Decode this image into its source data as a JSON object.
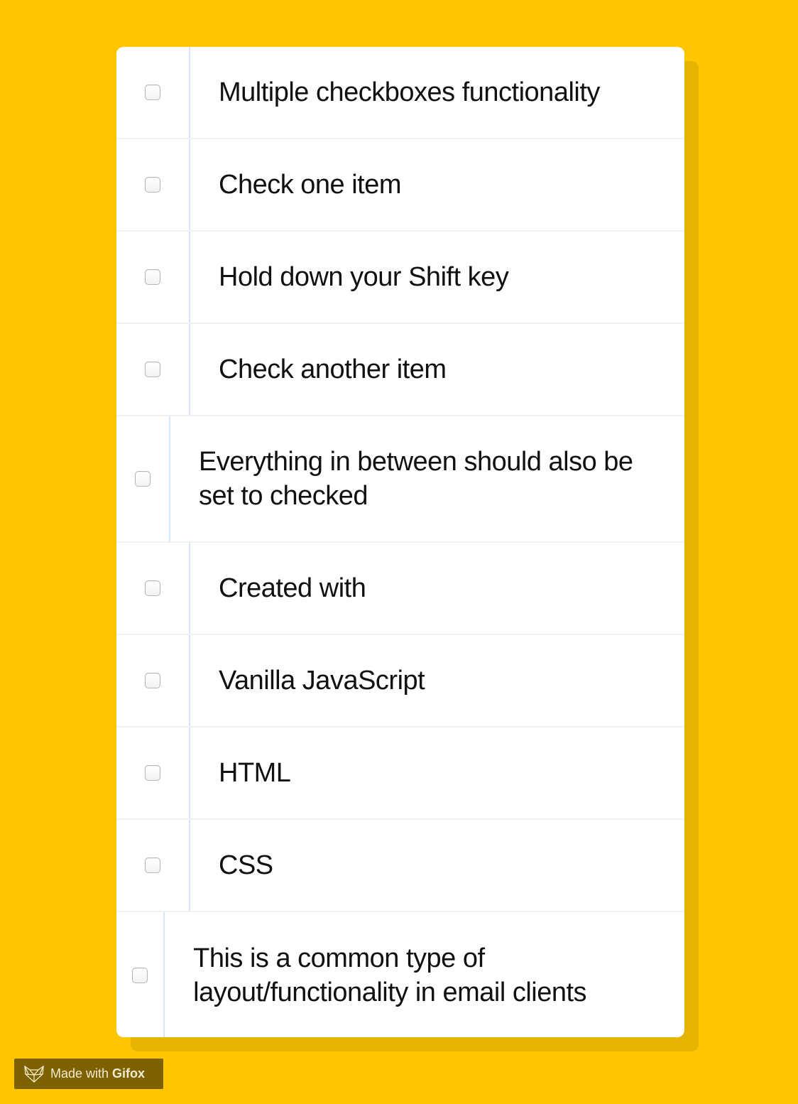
{
  "items": [
    {
      "label": "Multiple checkboxes functionality",
      "checked": false
    },
    {
      "label": "Check one item",
      "checked": false
    },
    {
      "label": "Hold down your Shift key",
      "checked": false
    },
    {
      "label": "Check another item",
      "checked": false
    },
    {
      "label": "Everything in between should also be set to checked",
      "checked": false
    },
    {
      "label": "Created with",
      "checked": false
    },
    {
      "label": "Vanilla JavaScript",
      "checked": false
    },
    {
      "label": "HTML",
      "checked": false
    },
    {
      "label": "CSS",
      "checked": false
    },
    {
      "label": "This is a common type of layout/functionality in email clients",
      "checked": false
    }
  ],
  "badge": {
    "prefix": "Made with",
    "brand": "Gifox",
    "icon": "fox-icon"
  },
  "colors": {
    "background": "#FFC600",
    "shadow": "#E6B400",
    "badge": "#7F6200",
    "divider": "#D6E6FB"
  }
}
